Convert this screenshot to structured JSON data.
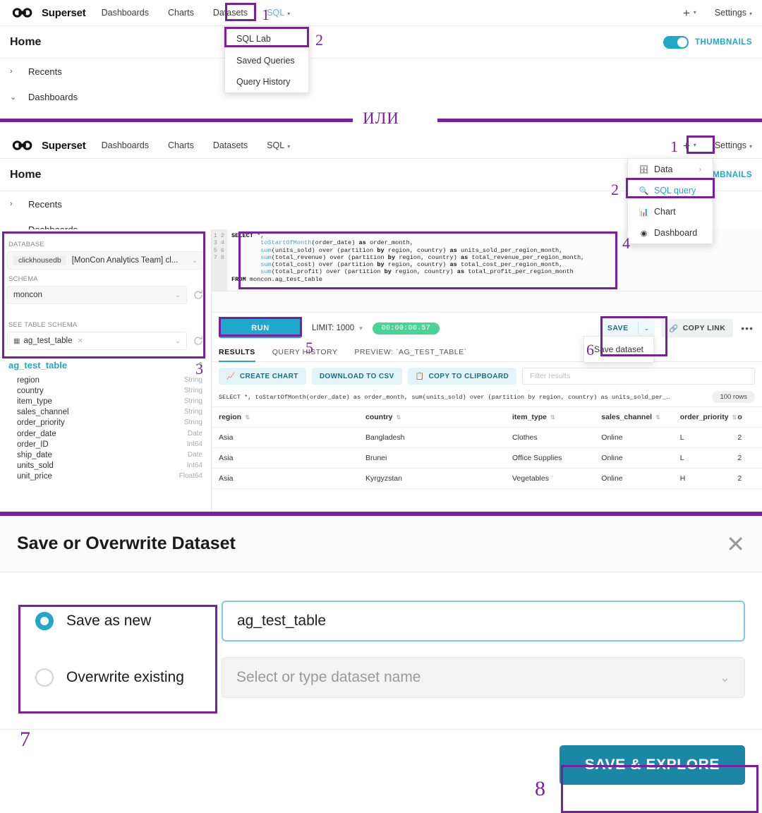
{
  "brand": {
    "name": "Superset",
    "logo_icon": "infinity-logo-icon"
  },
  "nav": {
    "links": [
      "Dashboards",
      "Charts",
      "Datasets"
    ],
    "sql_label": "SQL",
    "plus_label": "+",
    "settings_label": "Settings"
  },
  "home": {
    "title": "Home",
    "thumbnails_label": "THUMBNAILS",
    "recents_label": "Recents",
    "dashboards_label": "Dashboards"
  },
  "sql_menu": {
    "items": [
      "SQL Lab",
      "Saved Queries",
      "Query History"
    ],
    "highlighted": "SQL Lab"
  },
  "plus_menu": {
    "items": [
      {
        "label": "Data",
        "icon": "database-icon",
        "has_submenu": true
      },
      {
        "label": "SQL query",
        "icon": "search-icon",
        "has_submenu": false
      },
      {
        "label": "Chart",
        "icon": "chart-icon",
        "has_submenu": false
      },
      {
        "label": "Dashboard",
        "icon": "dashboard-icon",
        "has_submenu": false
      }
    ],
    "highlighted": "SQL query"
  },
  "divider": {
    "text": "ИЛИ"
  },
  "annotations": {
    "n1": "1",
    "n2": "2",
    "n1b": "1",
    "n2b": "2",
    "n3": "3",
    "n4": "4",
    "n5": "5",
    "n6": "6",
    "n7": "7",
    "n8": "8"
  },
  "sqllab": {
    "database_label": "DATABASE",
    "database_tag": "clickhousedb",
    "database_value": "[MonCon Analytics Team] cl...",
    "schema_label": "SCHEMA",
    "schema_value": "moncon",
    "see_table_schema_label": "SEE TABLE SCHEMA",
    "table_value": "ag_test_table",
    "schema_table_title": "ag_test_table",
    "columns": [
      {
        "name": "region",
        "type": "String"
      },
      {
        "name": "country",
        "type": "String"
      },
      {
        "name": "item_type",
        "type": "String"
      },
      {
        "name": "sales_channel",
        "type": "String"
      },
      {
        "name": "order_priority",
        "type": "String"
      },
      {
        "name": "order_date",
        "type": "Date"
      },
      {
        "name": "order_ID",
        "type": "Int64"
      },
      {
        "name": "ship_date",
        "type": "Date"
      },
      {
        "name": "units_sold",
        "type": "Int64"
      },
      {
        "name": "unit_price",
        "type": "Float64"
      }
    ],
    "editor": {
      "line_numbers": "1\n2\n3\n4\n5\n6\n7\n8",
      "sql_lines": [
        "SELECT *,",
        "        toStartOfMonth(order_date) as order_month,",
        "        sum(units_sold) over (partition by region, country) as units_sold_per_region_month,",
        "        sum(total_revenue) over (partition by region, country) as total_revenue_per_region_month,",
        "        sum(total_cost) over (partition by region, country) as total_cost_per_region_month,",
        "        sum(total_profit) over (partition by region, country) as total_profit_per_region_month",
        "FROM moncon.ag_test_table"
      ]
    },
    "run_label": "RUN",
    "limit_label": "LIMIT: 1000",
    "timer": "00:00:00.57",
    "save_label": "SAVE",
    "save_dataset_label": "Save dataset",
    "copy_link_label": "COPY LINK",
    "more_label": "•••",
    "tabs": [
      "RESULTS",
      "QUERY HISTORY",
      "PREVIEW: `AG_TEST_TABLE`"
    ],
    "active_tab": "RESULTS",
    "create_chart_label": "CREATE CHART",
    "download_csv_label": "DOWNLOAD TO CSV",
    "copy_clipboard_label": "COPY TO CLIPBOARD",
    "filter_placeholder": "Filter results",
    "query_preview": "SELECT *, toStartOfMonth(order_date) as order_month, sum(units_sold) over (partition by region, country) as units_sold_per_…",
    "rows_badge": "100 rows",
    "table_headers": [
      "region",
      "country",
      "item_type",
      "sales_channel",
      "order_priority",
      "o"
    ],
    "table_rows": [
      [
        "Asia",
        "Bangladesh",
        "Clothes",
        "Online",
        "L",
        "2"
      ],
      [
        "Asia",
        "Brunei",
        "Office Supplies",
        "Online",
        "L",
        "2"
      ],
      [
        "Asia",
        "Kyrgyzstan",
        "Vegetables",
        "Online",
        "H",
        "2"
      ]
    ]
  },
  "modal": {
    "title": "Save or Overwrite Dataset",
    "close_icon": "close-icon",
    "save_as_new_label": "Save as new",
    "save_as_new_value": "ag_test_table",
    "overwrite_label": "Overwrite existing",
    "overwrite_placeholder": "Select or type dataset name",
    "submit_label": "SAVE & EXPLORE"
  }
}
